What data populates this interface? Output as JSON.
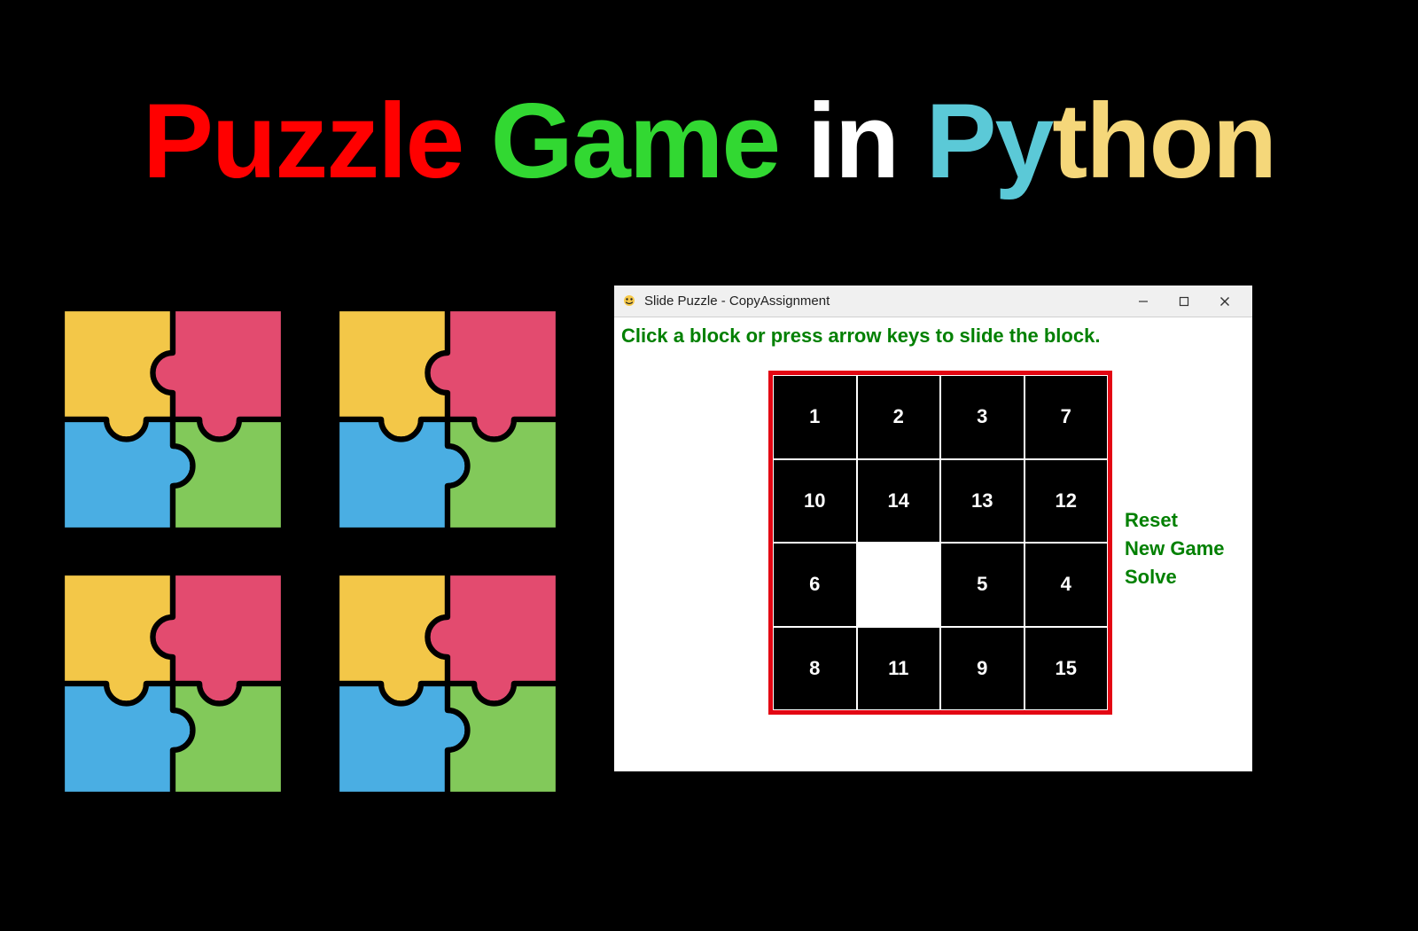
{
  "title": {
    "word1": "Puzzle",
    "word2": "Game",
    "word3": "in",
    "word4_a": "Py",
    "word4_b": "thon"
  },
  "puzzle_icon": {
    "colors": {
      "tl": "#f3c748",
      "tr": "#e34b6f",
      "bl": "#4aaee3",
      "br": "#82c95a",
      "stroke": "#000000"
    },
    "name": "four-piece-jigsaw-icon"
  },
  "window": {
    "title": "Slide Puzzle - CopyAssignment",
    "instruction": "Click a block or press arrow keys to slide the block.",
    "buttons": {
      "reset": "Reset",
      "new_game": "New Game",
      "solve": "Solve"
    },
    "controls": {
      "minimize": "minimize-icon",
      "maximize": "maximize-icon",
      "close": "close-icon"
    },
    "board": {
      "rows": 4,
      "cols": 4,
      "tiles": [
        [
          "1",
          "2",
          "3",
          "7"
        ],
        [
          "10",
          "14",
          "13",
          "12"
        ],
        [
          "6",
          "",
          "5",
          "4"
        ],
        [
          "8",
          "11",
          "9",
          "15"
        ]
      ]
    }
  }
}
